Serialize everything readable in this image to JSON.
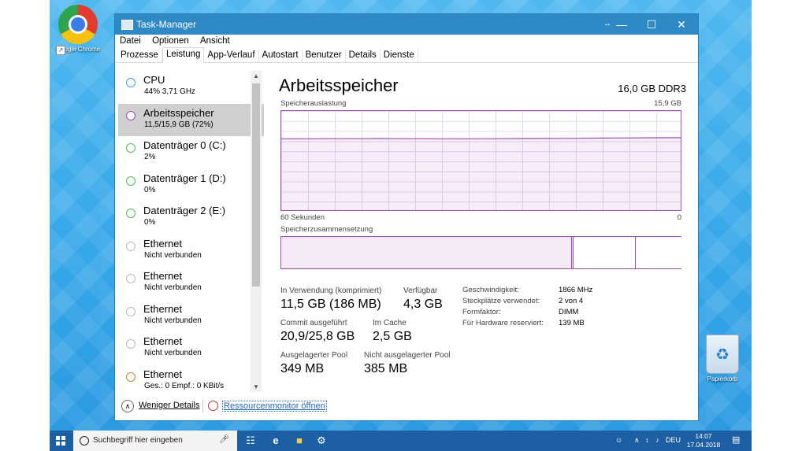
{
  "desktop": {
    "icons": [
      {
        "label": "Google Chrome"
      },
      {
        "label": "Papierkorb"
      }
    ]
  },
  "window": {
    "title": "Task-Manager",
    "controls": {
      "minimize": "—",
      "maximize": "☐",
      "close": "✕"
    }
  },
  "menu": [
    "Datei",
    "Optionen",
    "Ansicht"
  ],
  "tabs": [
    "Prozesse",
    "Leistung",
    "App-Verlauf",
    "Autostart",
    "Benutzer",
    "Details",
    "Dienste"
  ],
  "active_tab": "Leistung",
  "sidebar": {
    "items": [
      {
        "name": "CPU",
        "sub": "44% 3,71 GHz",
        "color": "#4a9fd8"
      },
      {
        "name": "Arbeitsspeicher",
        "sub": "11,5/15,9 GB (72%)",
        "color": "#9b4fb0"
      },
      {
        "name": "Datenträger 0 (C:)",
        "sub": "2%",
        "color": "#5cb85c"
      },
      {
        "name": "Datenträger 1 (D:)",
        "sub": "0%",
        "color": "#5cb85c"
      },
      {
        "name": "Datenträger 2 (E:)",
        "sub": "0%",
        "color": "#5cb85c"
      },
      {
        "name": "Ethernet",
        "sub": "Nicht verbunden",
        "color": "#bbbbbb"
      },
      {
        "name": "Ethernet",
        "sub": "Nicht verbunden",
        "color": "#bbbbbb"
      },
      {
        "name": "Ethernet",
        "sub": "Nicht verbunden",
        "color": "#bbbbbb"
      },
      {
        "name": "Ethernet",
        "sub": "Nicht verbunden",
        "color": "#bbbbbb"
      },
      {
        "name": "Ethernet",
        "sub": "Ges.: 0 Empf.: 0 KBit/s",
        "color": "#c9813a"
      }
    ]
  },
  "memory": {
    "title": "Arbeitsspeicher",
    "spec": "16,0 GB DDR3",
    "usage_label": "Speicherauslastung",
    "usage_max": "15,9 GB",
    "time_left": "60 Sekunden",
    "time_right": "0",
    "composition_label": "Speicherzusammensetzung",
    "usage_history_fraction": [
      0.72,
      0.72,
      0.721,
      0.721,
      0.721,
      0.722,
      0.721,
      0.721,
      0.72,
      0.72,
      0.72,
      0.721,
      0.722,
      0.723,
      0.724,
      0.725,
      0.727,
      0.728,
      0.729,
      0.73,
      0.731
    ],
    "composition_fractions": {
      "in_use": 0.726,
      "modified": 0.004,
      "standby": 0.156,
      "free": 0.114
    },
    "stats": {
      "in_use_label": "In Verwendung (komprimiert)",
      "in_use_value": "11,5 GB (186 MB)",
      "available_label": "Verfügbar",
      "available_value": "4,3 GB",
      "commit_label": "Commit ausgeführt",
      "commit_value": "20,9/25,8 GB",
      "cache_label": "Im Cache",
      "cache_value": "2,5 GB",
      "paged_label": "Ausgelagerter Pool",
      "paged_value": "349 MB",
      "nonpaged_label": "Nicht ausgelagerter Pool",
      "nonpaged_value": "385 MB"
    },
    "details": [
      {
        "key": "Geschwindigkeit:",
        "value": "1866 MHz"
      },
      {
        "key": "Steckplätze verwendet:",
        "value": "2 von 4"
      },
      {
        "key": "Formfaktor:",
        "value": "DIMM"
      },
      {
        "key": "Für Hardware reserviert:",
        "value": "139 MB"
      }
    ]
  },
  "footer": {
    "less_details": "Weniger Details",
    "resource_monitor": "Ressourcenmonitor öffnen"
  },
  "taskbar": {
    "search_placeholder": "Suchbegriff hier eingeben",
    "language": "DEU",
    "time": "14:07",
    "date": "17.04.2018"
  }
}
